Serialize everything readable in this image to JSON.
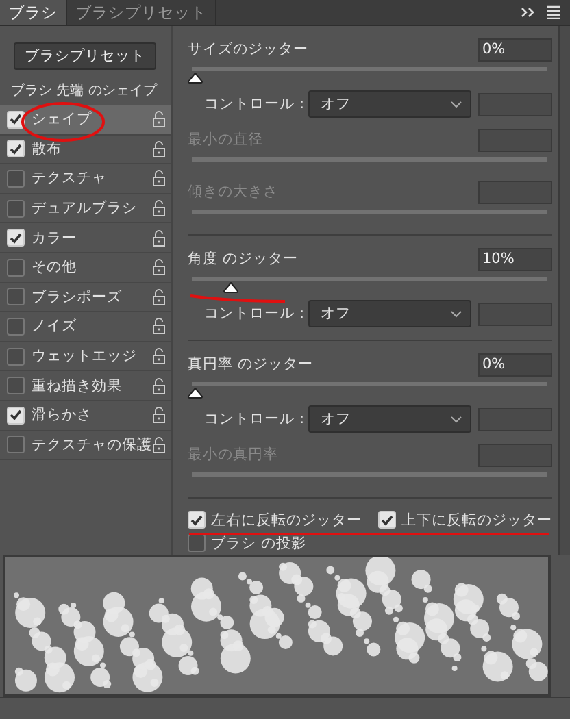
{
  "tabs": [
    {
      "label": "ブラシ",
      "selected": true
    },
    {
      "label": "ブラシプリセット",
      "selected": false
    }
  ],
  "preset_button": "ブラシプリセット",
  "sidebar": {
    "title": "ブラシ 先端 のシェイプ",
    "items": [
      {
        "label": "シェイプ",
        "checked": true,
        "selected": true
      },
      {
        "label": "散布",
        "checked": true,
        "selected": false
      },
      {
        "label": "テクスチャ",
        "checked": false,
        "selected": false
      },
      {
        "label": "デュアルブラシ",
        "checked": false,
        "selected": false
      },
      {
        "label": "カラー",
        "checked": true,
        "selected": false
      },
      {
        "label": "その他",
        "checked": false,
        "selected": false
      },
      {
        "label": "ブラシポーズ",
        "checked": false,
        "selected": false
      },
      {
        "label": "ノイズ",
        "checked": false,
        "selected": false
      },
      {
        "label": "ウェットエッジ",
        "checked": false,
        "selected": false
      },
      {
        "label": "重ね描き効果",
        "checked": false,
        "selected": false
      },
      {
        "label": "滑らかさ",
        "checked": true,
        "selected": false
      },
      {
        "label": "テクスチャの保護",
        "checked": false,
        "selected": false
      }
    ]
  },
  "sections": [
    {
      "rows": [
        {
          "kind": "jitter",
          "label": "サイズのジッター",
          "value": "0%",
          "level": 0
        },
        {
          "kind": "control",
          "label": "コントロール :",
          "value": "オフ"
        },
        {
          "kind": "dim",
          "label": "最小の直径"
        },
        {
          "kind": "dim",
          "label": "傾きの大きさ"
        }
      ]
    },
    {
      "rows": [
        {
          "kind": "jitter",
          "label": "角度 のジッター",
          "value": "10%",
          "level": 0.1
        },
        {
          "kind": "control",
          "label": "コントロール :",
          "value": "オフ"
        }
      ]
    },
    {
      "rows": [
        {
          "kind": "jitter",
          "label": "真円率 のジッター",
          "value": "0%",
          "level": 0
        },
        {
          "kind": "control",
          "label": "コントロール :",
          "value": "オフ"
        },
        {
          "kind": "dim",
          "label": "最小の真円率"
        }
      ]
    }
  ],
  "flips": [
    {
      "label": "左右に反転のジッター",
      "checked": true
    },
    {
      "label": "上下に反転のジッター",
      "checked": true
    }
  ],
  "projection": {
    "label": "ブラシ の投影",
    "checked": false
  }
}
